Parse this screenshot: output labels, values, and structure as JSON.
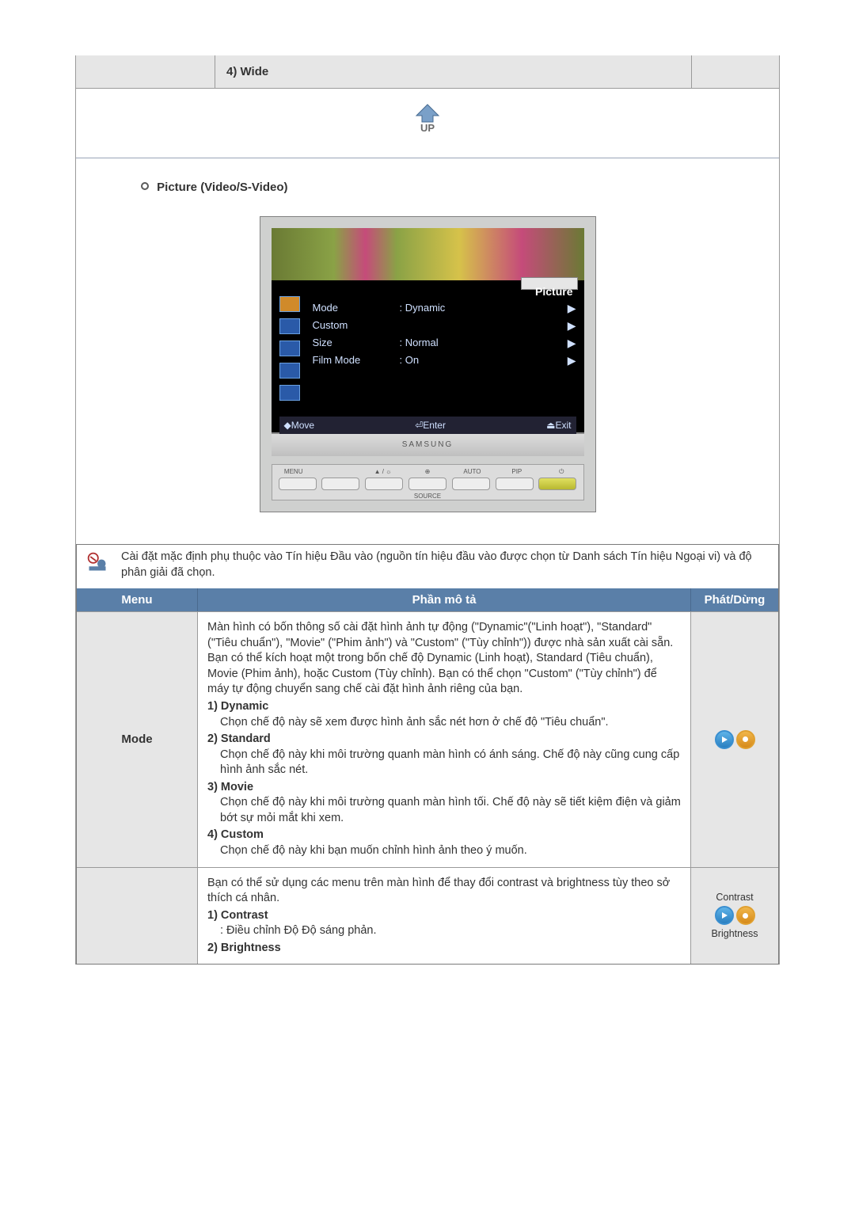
{
  "prev_size_row": "4) Wide",
  "up_label": "UP",
  "section_title": "Picture (Video/S-Video)",
  "osd": {
    "title": "Picture",
    "rows": [
      {
        "label": "Mode",
        "value": ": Dynamic"
      },
      {
        "label": "Custom",
        "value": ""
      },
      {
        "label": "Size",
        "value": ": Normal"
      },
      {
        "label": "Film Mode",
        "value": ": On"
      }
    ],
    "footer": {
      "move": "Move",
      "enter": "Enter",
      "exit": "Exit"
    },
    "barPrefix": {
      "move": "◆",
      "enter": "⏎",
      "exit": "⏏"
    },
    "bezel": "SAMSUNG",
    "base_labels": [
      "MENU",
      "",
      "▲ / ☼",
      "⊕",
      "AUTO",
      "PIP",
      "⏻"
    ],
    "base_source": "SOURCE"
  },
  "note_text": "Cài đặt mặc định phụ thuộc vào Tín hiệu Đầu vào (nguồn tín hiệu đầu vào được chọn từ Danh sách Tín hiệu Ngoại vi) và độ phân giải đã chọn.",
  "headers": {
    "menu": "Menu",
    "desc": "Phần mô tả",
    "play": "Phát/Dừng"
  },
  "row_mode": {
    "name": "Mode",
    "intro": "Màn hình có bốn thông số cài đặt hình ảnh tự động (\"Dynamic\"(\"Linh hoạt\"), \"Standard\"(\"Tiêu chuẩn\"), \"Movie\" (\"Phim ảnh\") và \"Custom\" (\"Tùy chỉnh\")) được nhà sản xuất cài sẵn. Bạn có thể kích hoạt một trong bốn chế độ Dynamic (Linh hoạt), Standard (Tiêu chuẩn), Movie (Phim ảnh), hoặc Custom (Tùy chỉnh). Bạn có thể chọn \"Custom\" (\"Tùy chỉnh\") để máy tự động chuyển sang chế cài đặt hình ảnh riêng của bạn.",
    "opt1_h": "1) Dynamic",
    "opt1_b": "Chọn chế độ này sẽ xem được hình ảnh sắc nét hơn ở chế độ \"Tiêu chuẩn\".",
    "opt2_h": "2) Standard",
    "opt2_b": "Chọn chế độ này khi môi trường quanh màn hình có ánh sáng. Chế độ này cũng cung cấp hình ảnh sắc nét.",
    "opt3_h": "3) Movie",
    "opt3_b": "Chọn chế độ này khi môi trường quanh màn hình tối. Chế độ này sẽ tiết kiệm điện và giảm bớt sự mỏi mắt khi xem.",
    "opt4_h": "4) Custom",
    "opt4_b": "Chọn chế độ này khi bạn muốn chỉnh hình ảnh theo ý muốn."
  },
  "row_custom": {
    "intro": "Bạn có thể sử dụng các menu trên màn hình để thay đổi contrast và brightness tùy theo sở thích cá nhân.",
    "opt1_h": "1) Contrast",
    "opt1_b": ": Điều chỉnh Độ Độ sáng phản.",
    "opt2_h": "2) Brightness",
    "side_label1": "Contrast",
    "side_label2": "Brightness"
  }
}
